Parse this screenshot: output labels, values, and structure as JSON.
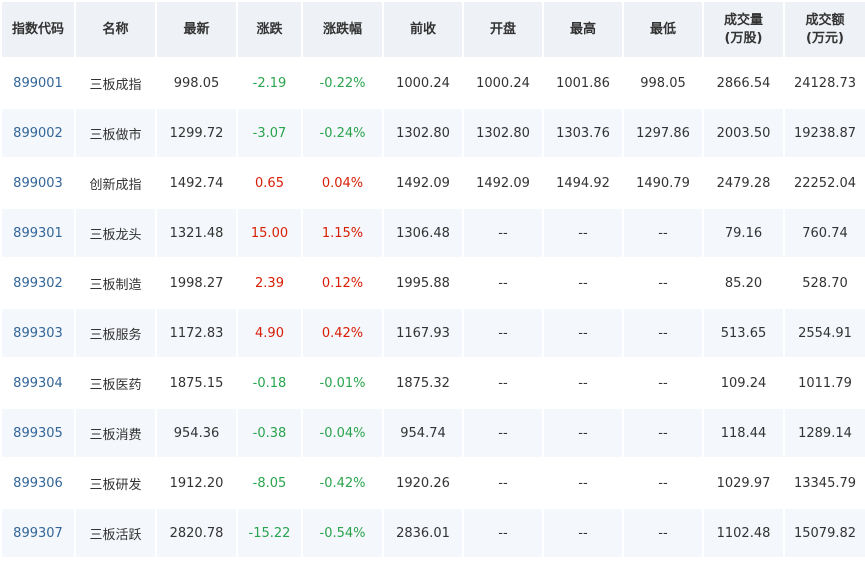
{
  "headers": [
    {
      "key": "code",
      "label": "指数代码",
      "label2": ""
    },
    {
      "key": "name",
      "label": "名称",
      "label2": ""
    },
    {
      "key": "latest",
      "label": "最新",
      "label2": ""
    },
    {
      "key": "change",
      "label": "涨跌",
      "label2": ""
    },
    {
      "key": "change_pct",
      "label": "涨跌幅",
      "label2": ""
    },
    {
      "key": "prev_close",
      "label": "前收",
      "label2": ""
    },
    {
      "key": "open",
      "label": "开盘",
      "label2": ""
    },
    {
      "key": "high",
      "label": "最高",
      "label2": ""
    },
    {
      "key": "low",
      "label": "最低",
      "label2": ""
    },
    {
      "key": "volume",
      "label": "成交量",
      "label2": "(万股)"
    },
    {
      "key": "amount",
      "label": "成交额",
      "label2": "(万元)"
    }
  ],
  "colors": {
    "up": "#d81e06",
    "down": "#2aa44d",
    "code": "#336699"
  },
  "rows": [
    {
      "code": "899001",
      "name": "三板成指",
      "latest": "998.05",
      "change": "-2.19",
      "change_pct": "-0.22%",
      "prev_close": "1000.24",
      "open": "1000.24",
      "high": "1001.86",
      "low": "998.05",
      "volume": "2866.54",
      "amount": "24128.73",
      "dir": "down"
    },
    {
      "code": "899002",
      "name": "三板做市",
      "latest": "1299.72",
      "change": "-3.07",
      "change_pct": "-0.24%",
      "prev_close": "1302.80",
      "open": "1302.80",
      "high": "1303.76",
      "low": "1297.86",
      "volume": "2003.50",
      "amount": "19238.87",
      "dir": "down"
    },
    {
      "code": "899003",
      "name": "创新成指",
      "latest": "1492.74",
      "change": "0.65",
      "change_pct": "0.04%",
      "prev_close": "1492.09",
      "open": "1492.09",
      "high": "1494.92",
      "low": "1490.79",
      "volume": "2479.28",
      "amount": "22252.04",
      "dir": "up"
    },
    {
      "code": "899301",
      "name": "三板龙头",
      "latest": "1321.48",
      "change": "15.00",
      "change_pct": "1.15%",
      "prev_close": "1306.48",
      "open": "--",
      "high": "--",
      "low": "--",
      "volume": "79.16",
      "amount": "760.74",
      "dir": "up"
    },
    {
      "code": "899302",
      "name": "三板制造",
      "latest": "1998.27",
      "change": "2.39",
      "change_pct": "0.12%",
      "prev_close": "1995.88",
      "open": "--",
      "high": "--",
      "low": "--",
      "volume": "85.20",
      "amount": "528.70",
      "dir": "up"
    },
    {
      "code": "899303",
      "name": "三板服务",
      "latest": "1172.83",
      "change": "4.90",
      "change_pct": "0.42%",
      "prev_close": "1167.93",
      "open": "--",
      "high": "--",
      "low": "--",
      "volume": "513.65",
      "amount": "2554.91",
      "dir": "up"
    },
    {
      "code": "899304",
      "name": "三板医药",
      "latest": "1875.15",
      "change": "-0.18",
      "change_pct": "-0.01%",
      "prev_close": "1875.32",
      "open": "--",
      "high": "--",
      "low": "--",
      "volume": "109.24",
      "amount": "1011.79",
      "dir": "down"
    },
    {
      "code": "899305",
      "name": "三板消费",
      "latest": "954.36",
      "change": "-0.38",
      "change_pct": "-0.04%",
      "prev_close": "954.74",
      "open": "--",
      "high": "--",
      "low": "--",
      "volume": "118.44",
      "amount": "1289.14",
      "dir": "down"
    },
    {
      "code": "899306",
      "name": "三板研发",
      "latest": "1912.20",
      "change": "-8.05",
      "change_pct": "-0.42%",
      "prev_close": "1920.26",
      "open": "--",
      "high": "--",
      "low": "--",
      "volume": "1029.97",
      "amount": "13345.79",
      "dir": "down"
    },
    {
      "code": "899307",
      "name": "三板活跃",
      "latest": "2820.78",
      "change": "-15.22",
      "change_pct": "-0.54%",
      "prev_close": "2836.01",
      "open": "--",
      "high": "--",
      "low": "--",
      "volume": "1102.48",
      "amount": "15079.82",
      "dir": "down"
    }
  ]
}
